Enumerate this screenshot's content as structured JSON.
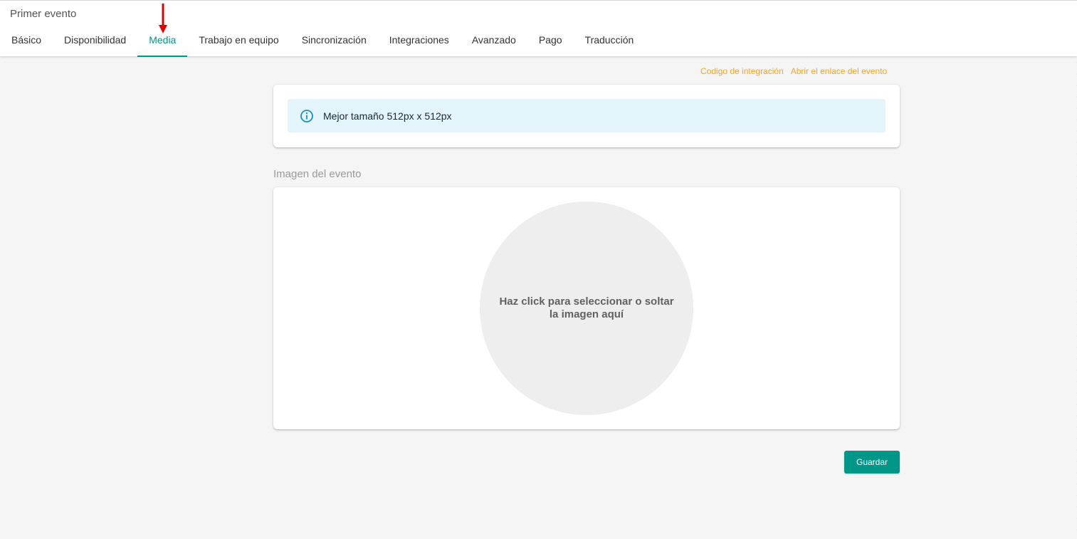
{
  "page": {
    "title": "Primer evento"
  },
  "tabs": [
    {
      "label": "Básico"
    },
    {
      "label": "Disponibilidad"
    },
    {
      "label": "Media",
      "active": true
    },
    {
      "label": "Trabajo en equipo"
    },
    {
      "label": "Sincronización"
    },
    {
      "label": "Integraciones"
    },
    {
      "label": "Avanzado"
    },
    {
      "label": "Pago"
    },
    {
      "label": "Traducción"
    }
  ],
  "links": {
    "integration_code": "Codigo de integración",
    "open_event_link": "Abrir el enlace del evento"
  },
  "info": {
    "text": "Mejor tamaño 512px x 512px",
    "icon": "info-icon"
  },
  "image_section": {
    "label": "Imagen del evento",
    "dropzone_text": "Haz click para seleccionar o soltar la imagen aquí"
  },
  "actions": {
    "save_label": "Guardar"
  },
  "colors": {
    "accent": "#009688",
    "link": "#f5a623",
    "info_bg": "#e3f4fb",
    "annotation_arrow": "#e00000"
  }
}
